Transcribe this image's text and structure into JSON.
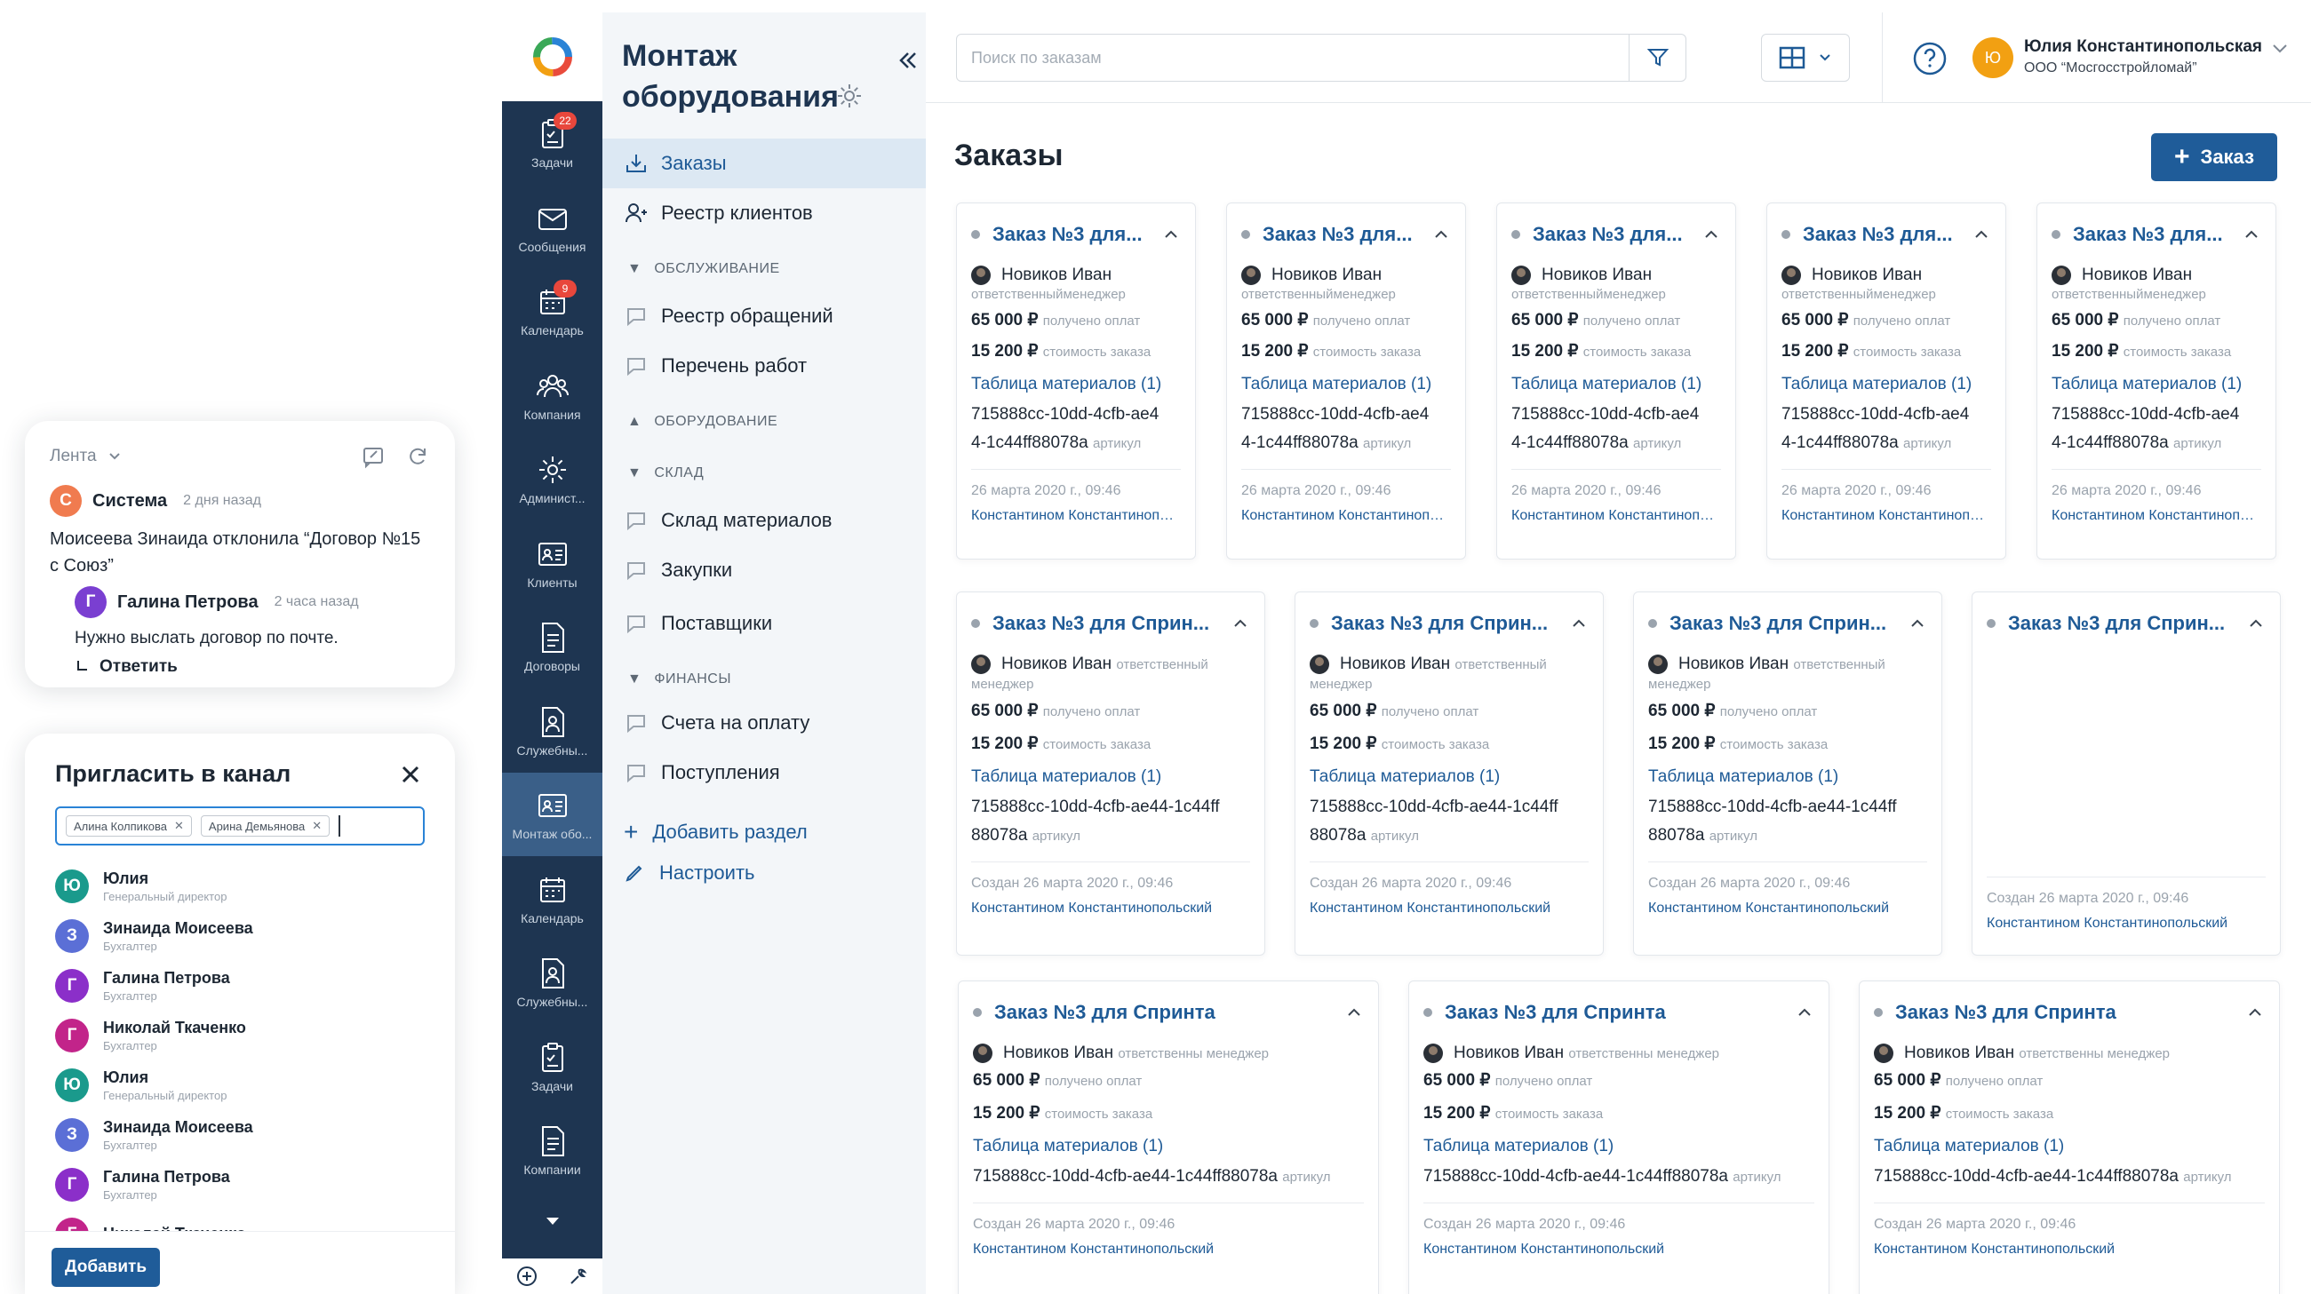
{
  "feed": {
    "title": "Лента",
    "item": {
      "avatar": "С",
      "author": "Система",
      "time": "2 дня назад",
      "text": "Моисеева Зинаида отклонила “Договор №15 с Союз”",
      "reply": {
        "avatar": "Г",
        "author": "Галина Петрова",
        "time": "2 часа назад",
        "text": "Нужно выслать договор по почте."
      },
      "answer_label": "Ответить"
    }
  },
  "invite": {
    "title": "Пригласить в канал",
    "chips": [
      "Алина Колпикова",
      "Арина Демьянова"
    ],
    "contacts": [
      {
        "avatar": "Ю",
        "name": "Юлия",
        "role": "Генеральный директор",
        "color": "#1a9a8c"
      },
      {
        "avatar": "З",
        "name": "Зинаида Моисеева",
        "role": "Бухгалтер",
        "color": "#5b6fd6"
      },
      {
        "avatar": "Г",
        "name": "Галина Петрова",
        "role": "Бухгалтер",
        "color": "#8b2fc9"
      },
      {
        "avatar": "Г",
        "name": "Николай Ткаченко",
        "role": "Бухгалтер",
        "color": "#c2248a"
      },
      {
        "avatar": "Ю",
        "name": "Юлия",
        "role": "Генеральный директор",
        "color": "#1a9a8c"
      },
      {
        "avatar": "З",
        "name": "Зинаида Моисеева",
        "role": "Бухгалтер",
        "color": "#5b6fd6"
      },
      {
        "avatar": "Г",
        "name": "Галина Петрова",
        "role": "Бухгалтер",
        "color": "#8b2fc9"
      },
      {
        "avatar": "Г",
        "name": "Николай Ткаченко",
        "role": "",
        "color": "#c2248a"
      }
    ],
    "add_label": "Добавить"
  },
  "rail": {
    "items": [
      {
        "label": "Задачи",
        "icon": "tasks-icon",
        "badge": "22"
      },
      {
        "label": "Сообщения",
        "icon": "messages-icon",
        "badge": ""
      },
      {
        "label": "Календарь",
        "icon": "calendar-icon",
        "badge": "9"
      },
      {
        "label": "Компания",
        "icon": "company-icon",
        "badge": ""
      },
      {
        "label": "Админист...",
        "icon": "settings-icon",
        "badge": ""
      },
      {
        "label": "Клиенты",
        "icon": "clients-icon",
        "badge": ""
      },
      {
        "label": "Договоры",
        "icon": "contracts-icon",
        "badge": ""
      },
      {
        "label": "Служебны...",
        "icon": "service-icon",
        "badge": ""
      },
      {
        "label": "Монтаж обо...",
        "icon": "install-icon",
        "badge": ""
      },
      {
        "label": "Календарь",
        "icon": "calendar-icon",
        "badge": ""
      },
      {
        "label": "Служебны...",
        "icon": "service-icon",
        "badge": ""
      },
      {
        "label": "Задачи",
        "icon": "tasks-icon",
        "badge": ""
      },
      {
        "label": "Компании",
        "icon": "companies-icon",
        "badge": ""
      }
    ]
  },
  "section": {
    "title": "Монтаж оборудования",
    "items": {
      "orders": "Заказы",
      "clients": "Реестр клиентов",
      "group_service": "ОБСЛУЖИВАНИЕ",
      "requests": "Реестр обращений",
      "works": "Перечень работ",
      "group_equipment": "ОБОРУДОВАНИЕ",
      "group_warehouse": "СКЛАД",
      "warehouse": "Склад материалов",
      "purchases": "Закупки",
      "suppliers": "Поставщики",
      "group_finance": "ФИНАНСЫ",
      "invoices": "Счета на оплату",
      "receipts": "Поступления",
      "add_section": "Добавить раздел",
      "configure": "Настроить"
    }
  },
  "topbar": {
    "search_placeholder": "Поиск по заказам",
    "user_initials": "Ю",
    "user_name": "Юлия Константинопольская",
    "user_org": "ООО “Мосгосстройломай”"
  },
  "main": {
    "title": "Заказы",
    "new_button": "Заказ"
  },
  "card_labels": {
    "responsible": "ответственный менеджер",
    "received": "получено оплат",
    "cost": "стоимость заказа",
    "article": "артикул",
    "created_prefix": "Создан"
  },
  "cards_row1": [
    {
      "title": "Заказ №3 для...",
      "person": "Новиков Иван",
      "role": "ответственныйменеджер",
      "received": "65 000 ₽",
      "cost": "15 200 ₽",
      "table": "Таблица материалов (1)",
      "article_1": "715888cc-10dd-4cfb-ae4",
      "article_2": "4-1c44ff88078a",
      "date": "26 марта 2020 г., 09:46",
      "user": "Константином Константинопольским"
    },
    {
      "title": "Заказ №3 для...",
      "person": "Новиков Иван",
      "role": "ответственныйменеджер",
      "received": "65 000 ₽",
      "cost": "15 200 ₽",
      "table": "Таблица материалов (1)",
      "article_1": "715888cc-10dd-4cfb-ae4",
      "article_2": "4-1c44ff88078a",
      "date": "26 марта 2020 г., 09:46",
      "user": "Константином Константинопольским"
    },
    {
      "title": "Заказ №3 для...",
      "person": "Новиков Иван",
      "role": "ответственныйменеджер",
      "received": "65 000 ₽",
      "cost": "15 200 ₽",
      "table": "Таблица материалов (1)",
      "article_1": "715888cc-10dd-4cfb-ae4",
      "article_2": "4-1c44ff88078a",
      "date": "26 марта 2020 г., 09:46",
      "user": "Константином Константинопольским"
    },
    {
      "title": "Заказ №3 для...",
      "person": "Новиков Иван",
      "role": "ответственныйменеджер",
      "received": "65 000 ₽",
      "cost": "15 200 ₽",
      "table": "Таблица материалов (1)",
      "article_1": "715888cc-10dd-4cfb-ae4",
      "article_2": "4-1c44ff88078a",
      "date": "26 марта 2020 г., 09:46",
      "user": "Константином Константинопольским"
    },
    {
      "title": "Заказ №3 для...",
      "person": "Новиков Иван",
      "role": "ответственныйменеджер",
      "received": "65 000 ₽",
      "cost": "15 200 ₽",
      "table": "Таблица материалов (1)",
      "article_1": "715888cc-10dd-4cfb-ae4",
      "article_2": "4-1c44ff88078a",
      "date": "26 марта 2020 г., 09:46",
      "user": "Константином Константинопольским"
    }
  ],
  "cards_row2": [
    {
      "title": "Заказ №3 для Сприн...",
      "person": "Новиков Иван",
      "role_1": "ответственный",
      "role_2": "менеджер",
      "received": "65 000 ₽",
      "cost": "15 200 ₽",
      "table": "Таблица материалов (1)",
      "article_1": "715888cc-10dd-4cfb-ae44-1c44ff",
      "article_2": "88078a",
      "date": "Создан 26 марта 2020 г., 09:46",
      "user": "Константином Константинопольский"
    },
    {
      "title": "Заказ №3 для Сприн...",
      "person": "Новиков Иван",
      "role_1": "ответственный",
      "role_2": "менеджер",
      "received": "65 000 ₽",
      "cost": "15 200 ₽",
      "table": "Таблица материалов (1)",
      "article_1": "715888cc-10dd-4cfb-ae44-1c44ff",
      "article_2": "88078a",
      "date": "Создан 26 марта 2020 г., 09:46",
      "user": "Константином Константинопольский"
    },
    {
      "title": "Заказ №3 для Сприн...",
      "person": "Новиков Иван",
      "role_1": "ответственный",
      "role_2": "менеджер",
      "received": "65 000 ₽",
      "cost": "15 200 ₽",
      "table": "Таблица материалов (1)",
      "article_1": "715888cc-10dd-4cfb-ae44-1c44ff",
      "article_2": "88078a",
      "date": "Создан 26 марта 2020 г., 09:46",
      "user": "Константином Константинопольский"
    }
  ],
  "card_row2_collapsed": {
    "title": "Заказ №3 для Сприн...",
    "date": "Создан 26 марта 2020 г., 09:46",
    "user": "Константином Константинопольский"
  },
  "cards_row3": [
    {
      "title": "Заказ №3 для Спринта",
      "person": "Новиков Иван",
      "role": "ответственны менеджер",
      "received": "65 000 ₽",
      "cost": "15 200 ₽",
      "table": "Таблица материалов (1)",
      "article": "715888cc-10dd-4cfb-ae44-1c44ff88078a",
      "date": "Создан 26 марта 2020 г., 09:46",
      "user": "Константином Константинопольский"
    },
    {
      "title": "Заказ №3 для Спринта",
      "person": "Новиков Иван",
      "role": "ответственны менеджер",
      "received": "65 000 ₽",
      "cost": "15 200 ₽",
      "table": "Таблица материалов (1)",
      "article": "715888cc-10dd-4cfb-ae44-1c44ff88078a",
      "date": "Создан 26 марта 2020 г., 09:46",
      "user": "Константином Константинопольский"
    },
    {
      "title": "Заказ №3 для Спринта",
      "person": "Новиков Иван",
      "role": "ответственны менеджер",
      "received": "65 000 ₽",
      "cost": "15 200 ₽",
      "table": "Таблица материалов (1)",
      "article": "715888cc-10dd-4cfb-ae44-1c44ff88078a",
      "date": "Создан 26 марта 2020 г., 09:46",
      "user": "Константином Константинопольский"
    }
  ],
  "colors": {
    "brand": "#1f5c99",
    "rail": "#1e3551",
    "accent_link": "#1e5a96",
    "system_avatar": "#f07b4f",
    "reply_avatar": "#7a3fd1"
  }
}
